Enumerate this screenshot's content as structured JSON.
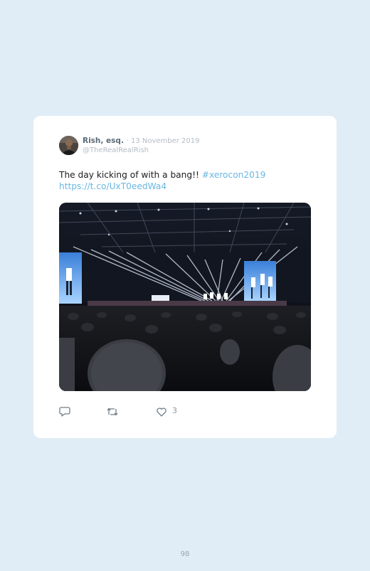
{
  "tweet": {
    "author_name": "Rish, esq.",
    "separator": " · ",
    "date": "13 November 2019",
    "handle": "@TheRealRealRish",
    "text": "The day kicking of with a bang!! ",
    "hashtag": "#xerocon2019",
    "link": "https://t.co/UxT0eedWa4",
    "like_count": "3"
  },
  "colors": {
    "page_background": "#e1edf6",
    "card_background": "#ffffff",
    "link": "#6ab7e0",
    "muted": "#b3bcc4"
  },
  "icons": {
    "reply": "speech-bubble-icon",
    "retweet": "retweet-icon",
    "like": "heart-icon"
  },
  "page": {
    "number": "98"
  }
}
